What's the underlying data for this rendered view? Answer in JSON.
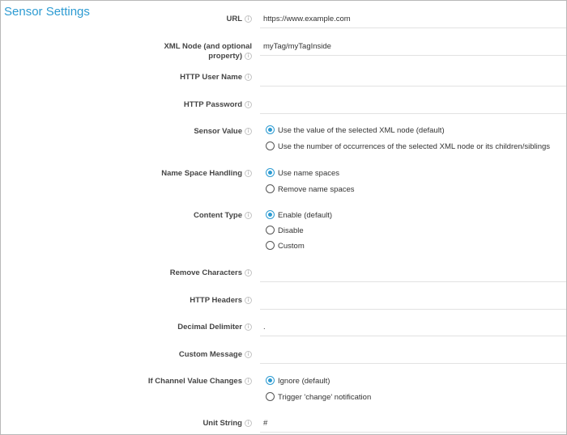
{
  "title": "Sensor Settings",
  "info_glyph": "i",
  "fields": {
    "url": {
      "label": "URL",
      "value": "https://www.example.com"
    },
    "xml_node": {
      "label_line1": "XML Node (and optional",
      "label_line2": "property)",
      "value": "myTag/myTagInside"
    },
    "http_user": {
      "label": "HTTP User Name",
      "value": ""
    },
    "http_password": {
      "label": "HTTP Password",
      "value": ""
    },
    "remove_chars": {
      "label": "Remove Characters",
      "value": ""
    },
    "http_headers": {
      "label": "HTTP Headers",
      "value": ""
    },
    "decimal_delimiter": {
      "label": "Decimal Delimiter",
      "value": "."
    },
    "custom_message": {
      "label": "Custom Message",
      "value": ""
    },
    "unit_string": {
      "label": "Unit String",
      "value": "#"
    }
  },
  "radios": {
    "sensor_value": {
      "label": "Sensor Value",
      "options": [
        {
          "label": "Use the value of the selected XML node  (default)",
          "checked": true
        },
        {
          "label": "Use the number of occurrences of the selected XML node or its children/siblings",
          "checked": false
        }
      ]
    },
    "namespace": {
      "label": "Name Space Handling",
      "options": [
        {
          "label": "Use name spaces",
          "checked": true
        },
        {
          "label": "Remove name spaces",
          "checked": false
        }
      ]
    },
    "content_type": {
      "label": "Content Type",
      "options": [
        {
          "label": "Enable (default)",
          "checked": true
        },
        {
          "label": "Disable",
          "checked": false
        },
        {
          "label": "Custom",
          "checked": false
        }
      ]
    },
    "channel_change": {
      "label": "If Channel Value Changes",
      "options": [
        {
          "label": "Ignore (default)",
          "checked": true
        },
        {
          "label": "Trigger 'change' notification",
          "checked": false
        }
      ]
    }
  },
  "colors": {
    "accent": "#2d9bd2",
    "divider": "#e2e2e2",
    "frame": "#b8b8b8"
  }
}
